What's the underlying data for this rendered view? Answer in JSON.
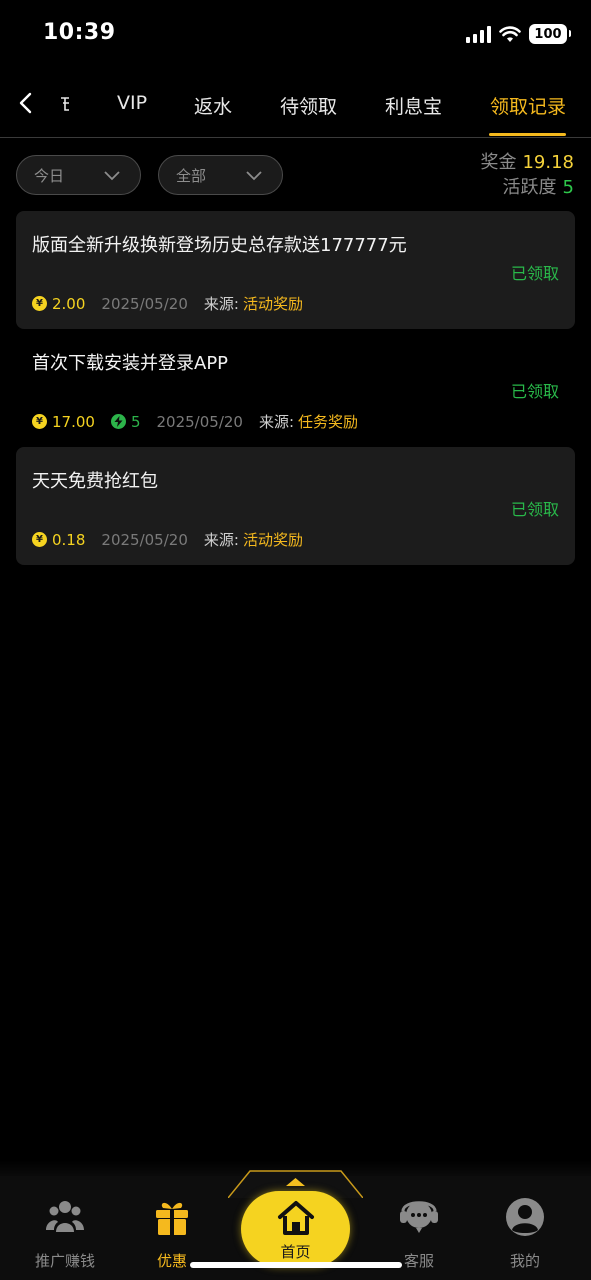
{
  "status_bar": {
    "time": "10:39",
    "battery": "100"
  },
  "tabs": [
    {
      "label": "VIP"
    },
    {
      "label": "返水"
    },
    {
      "label": "待领取"
    },
    {
      "label": "利息宝"
    },
    {
      "label": "领取记录",
      "active": true
    }
  ],
  "filters": {
    "date": "今日",
    "type": "全部"
  },
  "summary": {
    "bonus_label": "奖金",
    "bonus_value": "19.18",
    "activity_label": "活跃度",
    "activity_value": "5"
  },
  "records": [
    {
      "title": "版面全新升级换新登场历史总存款送177777元",
      "status": "已领取",
      "amount": "2.00",
      "date": "2025/05/20",
      "source_label": "来源:",
      "source": "活动奖励"
    },
    {
      "title": "首次下载安装并登录APP",
      "status": "已领取",
      "amount": "17.00",
      "activity": "5",
      "date": "2025/05/20",
      "source_label": "来源:",
      "source": "任务奖励"
    },
    {
      "title": "天天免费抢红包",
      "status": "已领取",
      "amount": "0.18",
      "date": "2025/05/20",
      "source_label": "来源:",
      "source": "活动奖励"
    }
  ],
  "bottom_nav": [
    {
      "label": "推广赚钱",
      "icon": "people-icon"
    },
    {
      "label": "优惠",
      "icon": "gift-icon",
      "active": true
    },
    {
      "label": "首页",
      "icon": "home-icon"
    },
    {
      "label": "客服",
      "icon": "headset-icon"
    },
    {
      "label": "我的",
      "icon": "user-icon"
    }
  ],
  "colors": {
    "accent": "#f5b91e",
    "coin": "#f5d320",
    "success": "#29b94a",
    "card": "#1c1c1c"
  }
}
